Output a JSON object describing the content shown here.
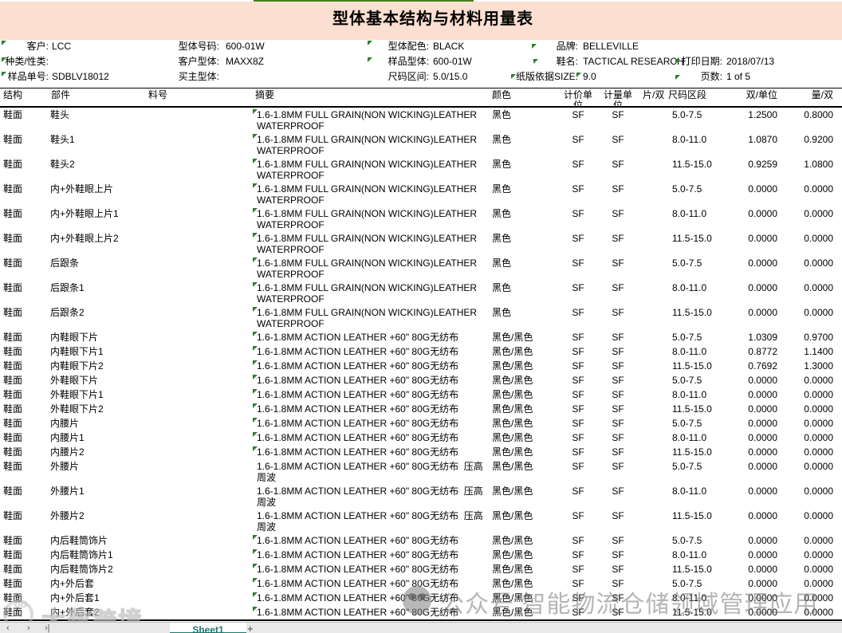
{
  "title": "型体基本结构与材料用量表",
  "header": {
    "col1": [
      {
        "label": "客户:",
        "value": "LCC"
      },
      {
        "label": "种类/性类:",
        "value": ""
      },
      {
        "label": "样品单号:",
        "value": "SDBLV18012"
      }
    ],
    "col2": [
      {
        "label": "型体号码:",
        "value": "600-01W"
      },
      {
        "label": "客户型体:",
        "value": "MAXX8Z"
      },
      {
        "label": "买主型体:",
        "value": ""
      }
    ],
    "col3": [
      {
        "label": "型体配色:",
        "value": "BLACK"
      },
      {
        "label": "样品型体:",
        "value": "600-01W"
      },
      {
        "label": "尺码区间:",
        "value": "5.0/15.0"
      }
    ],
    "col4": [
      {
        "label": "品牌:",
        "value": "BELLEVILLE"
      },
      {
        "label": "鞋名:",
        "value": "TACTICAL RESEARCH"
      },
      {
        "label": "纸版依据SIZE:",
        "value": "9.0"
      }
    ],
    "col5": [
      {
        "label": "",
        "value": ""
      },
      {
        "label": "打印日期:",
        "value": "2018/07/13"
      },
      {
        "label": "页数:",
        "value": "1 of 5"
      }
    ]
  },
  "table": {
    "columns": [
      "结构",
      "部件",
      "料号",
      "摘要",
      "颜色",
      "计价单位",
      "计量单位",
      "片/双",
      "尺码区段",
      "双/单位",
      "量/双"
    ],
    "rows": [
      {
        "structure": "鞋面",
        "part": "鞋头",
        "material_no": "",
        "summary": [
          "1.6-1.8MM FULL GRAIN(NON WICKING)LEATHER",
          "WATERPROOF"
        ],
        "color": "黑色",
        "price_unit": "SF",
        "measure_unit": "SF",
        "pieces_per_pair": "",
        "size_range": "5.0-7.5",
        "pairs_per_unit": "1.2500",
        "qty_per_pair": "0.8000",
        "flag": true
      },
      {
        "structure": "鞋面",
        "part": "鞋头1",
        "material_no": "",
        "summary": [
          "1.6-1.8MM FULL GRAIN(NON WICKING)LEATHER",
          "WATERPROOF"
        ],
        "color": "黑色",
        "price_unit": "SF",
        "measure_unit": "SF",
        "pieces_per_pair": "",
        "size_range": "8.0-11.0",
        "pairs_per_unit": "1.0870",
        "qty_per_pair": "0.9200",
        "flag": true
      },
      {
        "structure": "鞋面",
        "part": "鞋头2",
        "material_no": "",
        "summary": [
          "1.6-1.8MM FULL GRAIN(NON WICKING)LEATHER",
          "WATERPROOF"
        ],
        "color": "黑色",
        "price_unit": "SF",
        "measure_unit": "SF",
        "pieces_per_pair": "",
        "size_range": "11.5-15.0",
        "pairs_per_unit": "0.9259",
        "qty_per_pair": "1.0800",
        "flag": true
      },
      {
        "structure": "鞋面",
        "part": "内+外鞋眼上片",
        "material_no": "",
        "summary": [
          "1.6-1.8MM FULL GRAIN(NON WICKING)LEATHER",
          "WATERPROOF"
        ],
        "color": "黑色",
        "price_unit": "SF",
        "measure_unit": "SF",
        "pieces_per_pair": "",
        "size_range": "5.0-7.5",
        "pairs_per_unit": "0.0000",
        "qty_per_pair": "0.0000",
        "flag": true
      },
      {
        "structure": "鞋面",
        "part": "内+外鞋眼上片1",
        "material_no": "",
        "summary": [
          "1.6-1.8MM FULL GRAIN(NON WICKING)LEATHER",
          "WATERPROOF"
        ],
        "color": "黑色",
        "price_unit": "SF",
        "measure_unit": "SF",
        "pieces_per_pair": "",
        "size_range": "8.0-11.0",
        "pairs_per_unit": "0.0000",
        "qty_per_pair": "0.0000",
        "flag": true
      },
      {
        "structure": "鞋面",
        "part": "内+外鞋眼上片2",
        "material_no": "",
        "summary": [
          "1.6-1.8MM FULL GRAIN(NON WICKING)LEATHER",
          "WATERPROOF"
        ],
        "color": "黑色",
        "price_unit": "SF",
        "measure_unit": "SF",
        "pieces_per_pair": "",
        "size_range": "11.5-15.0",
        "pairs_per_unit": "0.0000",
        "qty_per_pair": "0.0000",
        "flag": true
      },
      {
        "structure": "鞋面",
        "part": "后跟条",
        "material_no": "",
        "summary": [
          "1.6-1.8MM FULL GRAIN(NON WICKING)LEATHER",
          "WATERPROOF"
        ],
        "color": "黑色",
        "price_unit": "SF",
        "measure_unit": "SF",
        "pieces_per_pair": "",
        "size_range": "5.0-7.5",
        "pairs_per_unit": "0.0000",
        "qty_per_pair": "0.0000",
        "flag": true
      },
      {
        "structure": "鞋面",
        "part": "后跟条1",
        "material_no": "",
        "summary": [
          "1.6-1.8MM FULL GRAIN(NON WICKING)LEATHER",
          "WATERPROOF"
        ],
        "color": "黑色",
        "price_unit": "SF",
        "measure_unit": "SF",
        "pieces_per_pair": "",
        "size_range": "8.0-11.0",
        "pairs_per_unit": "0.0000",
        "qty_per_pair": "0.0000",
        "flag": true
      },
      {
        "structure": "鞋面",
        "part": "后跟条2",
        "material_no": "",
        "summary": [
          "1.6-1.8MM FULL GRAIN(NON WICKING)LEATHER",
          "WATERPROOF"
        ],
        "color": "黑色",
        "price_unit": "SF",
        "measure_unit": "SF",
        "pieces_per_pair": "",
        "size_range": "11.5-15.0",
        "pairs_per_unit": "0.0000",
        "qty_per_pair": "0.0000",
        "flag": true
      },
      {
        "structure": "鞋面",
        "part": "内鞋眼下片",
        "material_no": "",
        "summary": [
          "1.6-1.8MM ACTION LEATHER +60\" 80G无纺布"
        ],
        "color": "黑色/黑色",
        "price_unit": "SF",
        "measure_unit": "SF",
        "pieces_per_pair": "",
        "size_range": "5.0-7.5",
        "pairs_per_unit": "1.0309",
        "qty_per_pair": "0.9700",
        "flag": true
      },
      {
        "structure": "鞋面",
        "part": "内鞋眼下片1",
        "material_no": "",
        "summary": [
          "1.6-1.8MM ACTION LEATHER +60\" 80G无纺布"
        ],
        "color": "黑色/黑色",
        "price_unit": "SF",
        "measure_unit": "SF",
        "pieces_per_pair": "",
        "size_range": "8.0-11.0",
        "pairs_per_unit": "0.8772",
        "qty_per_pair": "1.1400",
        "flag": true
      },
      {
        "structure": "鞋面",
        "part": "内鞋眼下片2",
        "material_no": "",
        "summary": [
          "1.6-1.8MM ACTION LEATHER +60\" 80G无纺布"
        ],
        "color": "黑色/黑色",
        "price_unit": "SF",
        "measure_unit": "SF",
        "pieces_per_pair": "",
        "size_range": "11.5-15.0",
        "pairs_per_unit": "0.7692",
        "qty_per_pair": "1.3000",
        "flag": true
      },
      {
        "structure": "鞋面",
        "part": "外鞋眼下片",
        "material_no": "",
        "summary": [
          "1.6-1.8MM ACTION LEATHER +60\" 80G无纺布"
        ],
        "color": "黑色/黑色",
        "price_unit": "SF",
        "measure_unit": "SF",
        "pieces_per_pair": "",
        "size_range": "5.0-7.5",
        "pairs_per_unit": "0.0000",
        "qty_per_pair": "0.0000",
        "flag": true
      },
      {
        "structure": "鞋面",
        "part": "外鞋眼下片1",
        "material_no": "",
        "summary": [
          "1.6-1.8MM ACTION LEATHER +60\" 80G无纺布"
        ],
        "color": "黑色/黑色",
        "price_unit": "SF",
        "measure_unit": "SF",
        "pieces_per_pair": "",
        "size_range": "8.0-11.0",
        "pairs_per_unit": "0.0000",
        "qty_per_pair": "0.0000",
        "flag": true
      },
      {
        "structure": "鞋面",
        "part": "外鞋眼下片2",
        "material_no": "",
        "summary": [
          "1.6-1.8MM ACTION LEATHER +60\" 80G无纺布"
        ],
        "color": "黑色/黑色",
        "price_unit": "SF",
        "measure_unit": "SF",
        "pieces_per_pair": "",
        "size_range": "11.5-15.0",
        "pairs_per_unit": "0.0000",
        "qty_per_pair": "0.0000",
        "flag": true
      },
      {
        "structure": "鞋面",
        "part": "内腰片",
        "material_no": "",
        "summary": [
          "1.6-1.8MM ACTION LEATHER +60\" 80G无纺布"
        ],
        "color": "黑色/黑色",
        "price_unit": "SF",
        "measure_unit": "SF",
        "pieces_per_pair": "",
        "size_range": "5.0-7.5",
        "pairs_per_unit": "0.0000",
        "qty_per_pair": "0.0000",
        "flag": true
      },
      {
        "structure": "鞋面",
        "part": "内腰片1",
        "material_no": "",
        "summary": [
          "1.6-1.8MM ACTION LEATHER +60\" 80G无纺布"
        ],
        "color": "黑色/黑色",
        "price_unit": "SF",
        "measure_unit": "SF",
        "pieces_per_pair": "",
        "size_range": "8.0-11.0",
        "pairs_per_unit": "0.0000",
        "qty_per_pair": "0.0000",
        "flag": true
      },
      {
        "structure": "鞋面",
        "part": "内腰片2",
        "material_no": "",
        "summary": [
          "1.6-1.8MM ACTION LEATHER +60\" 80G无纺布"
        ],
        "color": "黑色/黑色",
        "price_unit": "SF",
        "measure_unit": "SF",
        "pieces_per_pair": "",
        "size_range": "11.5-15.0",
        "pairs_per_unit": "0.0000",
        "qty_per_pair": "0.0000",
        "flag": true
      },
      {
        "structure": "鞋面",
        "part": "外腰片",
        "material_no": "",
        "summary": [
          "1.6-1.8MM ACTION LEATHER +60\" 80G无纺布  压高",
          "周波"
        ],
        "color": "黑色/黑色",
        "price_unit": "SF",
        "measure_unit": "SF",
        "pieces_per_pair": "",
        "size_range": "5.0-7.5",
        "pairs_per_unit": "0.0000",
        "qty_per_pair": "0.0000",
        "flag": false
      },
      {
        "structure": "鞋面",
        "part": "外腰片1",
        "material_no": "",
        "summary": [
          "1.6-1.8MM ACTION LEATHER +60\" 80G无纺布  压高",
          "周波"
        ],
        "color": "黑色/黑色",
        "price_unit": "SF",
        "measure_unit": "SF",
        "pieces_per_pair": "",
        "size_range": "8.0-11.0",
        "pairs_per_unit": "0.0000",
        "qty_per_pair": "0.0000",
        "flag": false
      },
      {
        "structure": "鞋面",
        "part": "外腰片2",
        "material_no": "",
        "summary": [
          "1.6-1.8MM ACTION LEATHER +60\" 80G无纺布  压高",
          "周波"
        ],
        "color": "黑色/黑色",
        "price_unit": "SF",
        "measure_unit": "SF",
        "pieces_per_pair": "",
        "size_range": "11.5-15.0",
        "pairs_per_unit": "0.0000",
        "qty_per_pair": "0.0000",
        "flag": false
      },
      {
        "structure": "鞋面",
        "part": "内后鞋筒饰片",
        "material_no": "",
        "summary": [
          "1.6-1.8MM ACTION LEATHER +60\" 80G无纺布"
        ],
        "color": "黑色/黑色",
        "price_unit": "SF",
        "measure_unit": "SF",
        "pieces_per_pair": "",
        "size_range": "5.0-7.5",
        "pairs_per_unit": "0.0000",
        "qty_per_pair": "0.0000",
        "flag": true
      },
      {
        "structure": "鞋面",
        "part": "内后鞋筒饰片1",
        "material_no": "",
        "summary": [
          "1.6-1.8MM ACTION LEATHER +60\" 80G无纺布"
        ],
        "color": "黑色/黑色",
        "price_unit": "SF",
        "measure_unit": "SF",
        "pieces_per_pair": "",
        "size_range": "8.0-11.0",
        "pairs_per_unit": "0.0000",
        "qty_per_pair": "0.0000",
        "flag": true
      },
      {
        "structure": "鞋面",
        "part": "内后鞋筒饰片2",
        "material_no": "",
        "summary": [
          "1.6-1.8MM ACTION LEATHER +60\" 80G无纺布"
        ],
        "color": "黑色/黑色",
        "price_unit": "SF",
        "measure_unit": "SF",
        "pieces_per_pair": "",
        "size_range": "11.5-15.0",
        "pairs_per_unit": "0.0000",
        "qty_per_pair": "0.0000",
        "flag": true
      },
      {
        "structure": "鞋面",
        "part": "内+外后套",
        "material_no": "",
        "summary": [
          "1.6-1.8MM ACTION LEATHER +60\" 80G无纺布"
        ],
        "color": "黑色/黑色",
        "price_unit": "SF",
        "measure_unit": "SF",
        "pieces_per_pair": "",
        "size_range": "5.0-7.5",
        "pairs_per_unit": "0.0000",
        "qty_per_pair": "0.0000",
        "flag": true
      },
      {
        "structure": "鞋面",
        "part": "内+外后套1",
        "material_no": "",
        "summary": [
          "1.6-1.8MM ACTION LEATHER +60\" 80G无纺布"
        ],
        "color": "黑色/黑色",
        "price_unit": "SF",
        "measure_unit": "SF",
        "pieces_per_pair": "",
        "size_range": "8.0-11.0",
        "pairs_per_unit": "0.0000",
        "qty_per_pair": "0.0000",
        "flag": true
      },
      {
        "structure": "鞋面",
        "part": "内+外后套2",
        "material_no": "",
        "summary": [
          "1.6-1.8MM ACTION LEATHER +60\" 80G无纺布"
        ],
        "color": "黑色/黑色",
        "price_unit": "SF",
        "measure_unit": "SF",
        "pieces_per_pair": "",
        "size_range": "11.5-15.0",
        "pairs_per_unit": "0.0000",
        "qty_per_pair": "0.0000",
        "flag": true
      }
    ]
  },
  "sheet_bar": {
    "nav": [
      "‹",
      "›",
      "›|"
    ],
    "tab": "Sheet1",
    "add": "+"
  },
  "watermarks": {
    "bottom_left": "大数跨境",
    "center": "公众号 智能物流仓储领域管理应用"
  },
  "colors": {
    "banner_peach": "#fbdfd0",
    "top_bar_green": "#45801f",
    "comment_flag_green": "#2d7d2d",
    "sheet_tab_teal": "#1b7a6d"
  }
}
